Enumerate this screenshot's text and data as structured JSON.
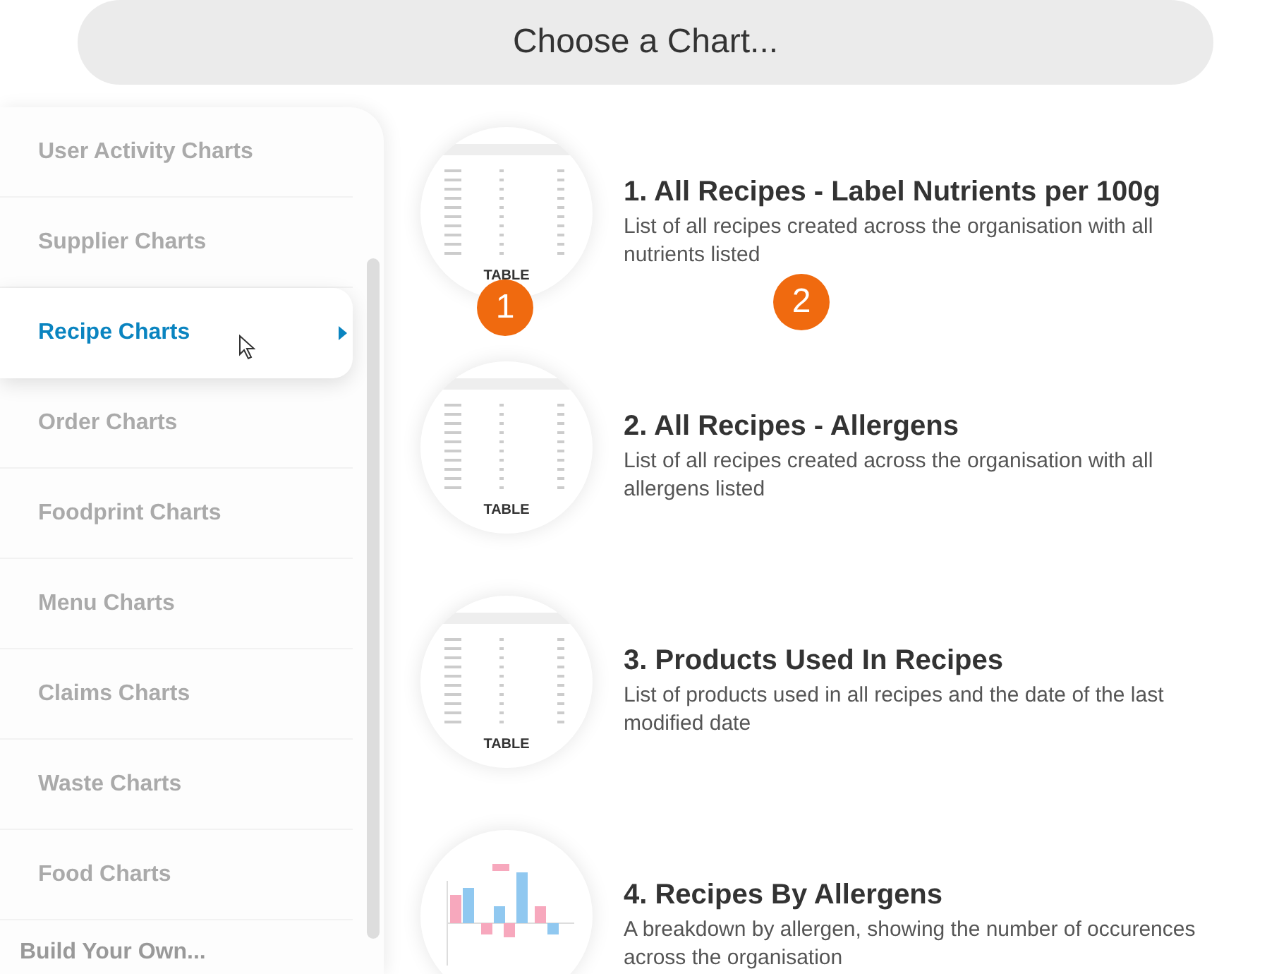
{
  "header": {
    "title": "Choose a Chart..."
  },
  "sidebar": {
    "items": [
      {
        "label": "User Activity Charts",
        "selected": false
      },
      {
        "label": "Supplier Charts",
        "selected": false
      },
      {
        "label": "Recipe Charts",
        "selected": true
      },
      {
        "label": "Order Charts",
        "selected": false
      },
      {
        "label": "Foodprint Charts",
        "selected": false
      },
      {
        "label": "Menu Charts",
        "selected": false
      },
      {
        "label": "Claims Charts",
        "selected": false
      },
      {
        "label": "Waste Charts",
        "selected": false
      },
      {
        "label": "Food Charts",
        "selected": false
      }
    ],
    "footer": "Build Your Own..."
  },
  "charts": [
    {
      "kind": "table",
      "thumb_label": "TABLE",
      "title": "1. All Recipes - Label Nutrients per 100g",
      "description": "List of all recipes created across the organisation with all nutrients listed",
      "thumb_marker": "1",
      "text_marker": "2"
    },
    {
      "kind": "table",
      "thumb_label": "TABLE",
      "title": "2. All Recipes - Allergens",
      "description": "List of all recipes created across the organisation with all allergens listed"
    },
    {
      "kind": "table",
      "thumb_label": "TABLE",
      "title": "3. Products Used In Recipes",
      "description": "List of products used in all recipes and the date of the last modified date"
    },
    {
      "kind": "bar",
      "title": "4. Recipes By Allergens",
      "description": "A breakdown by allergen, showing the number of occurences across the organisation"
    }
  ]
}
